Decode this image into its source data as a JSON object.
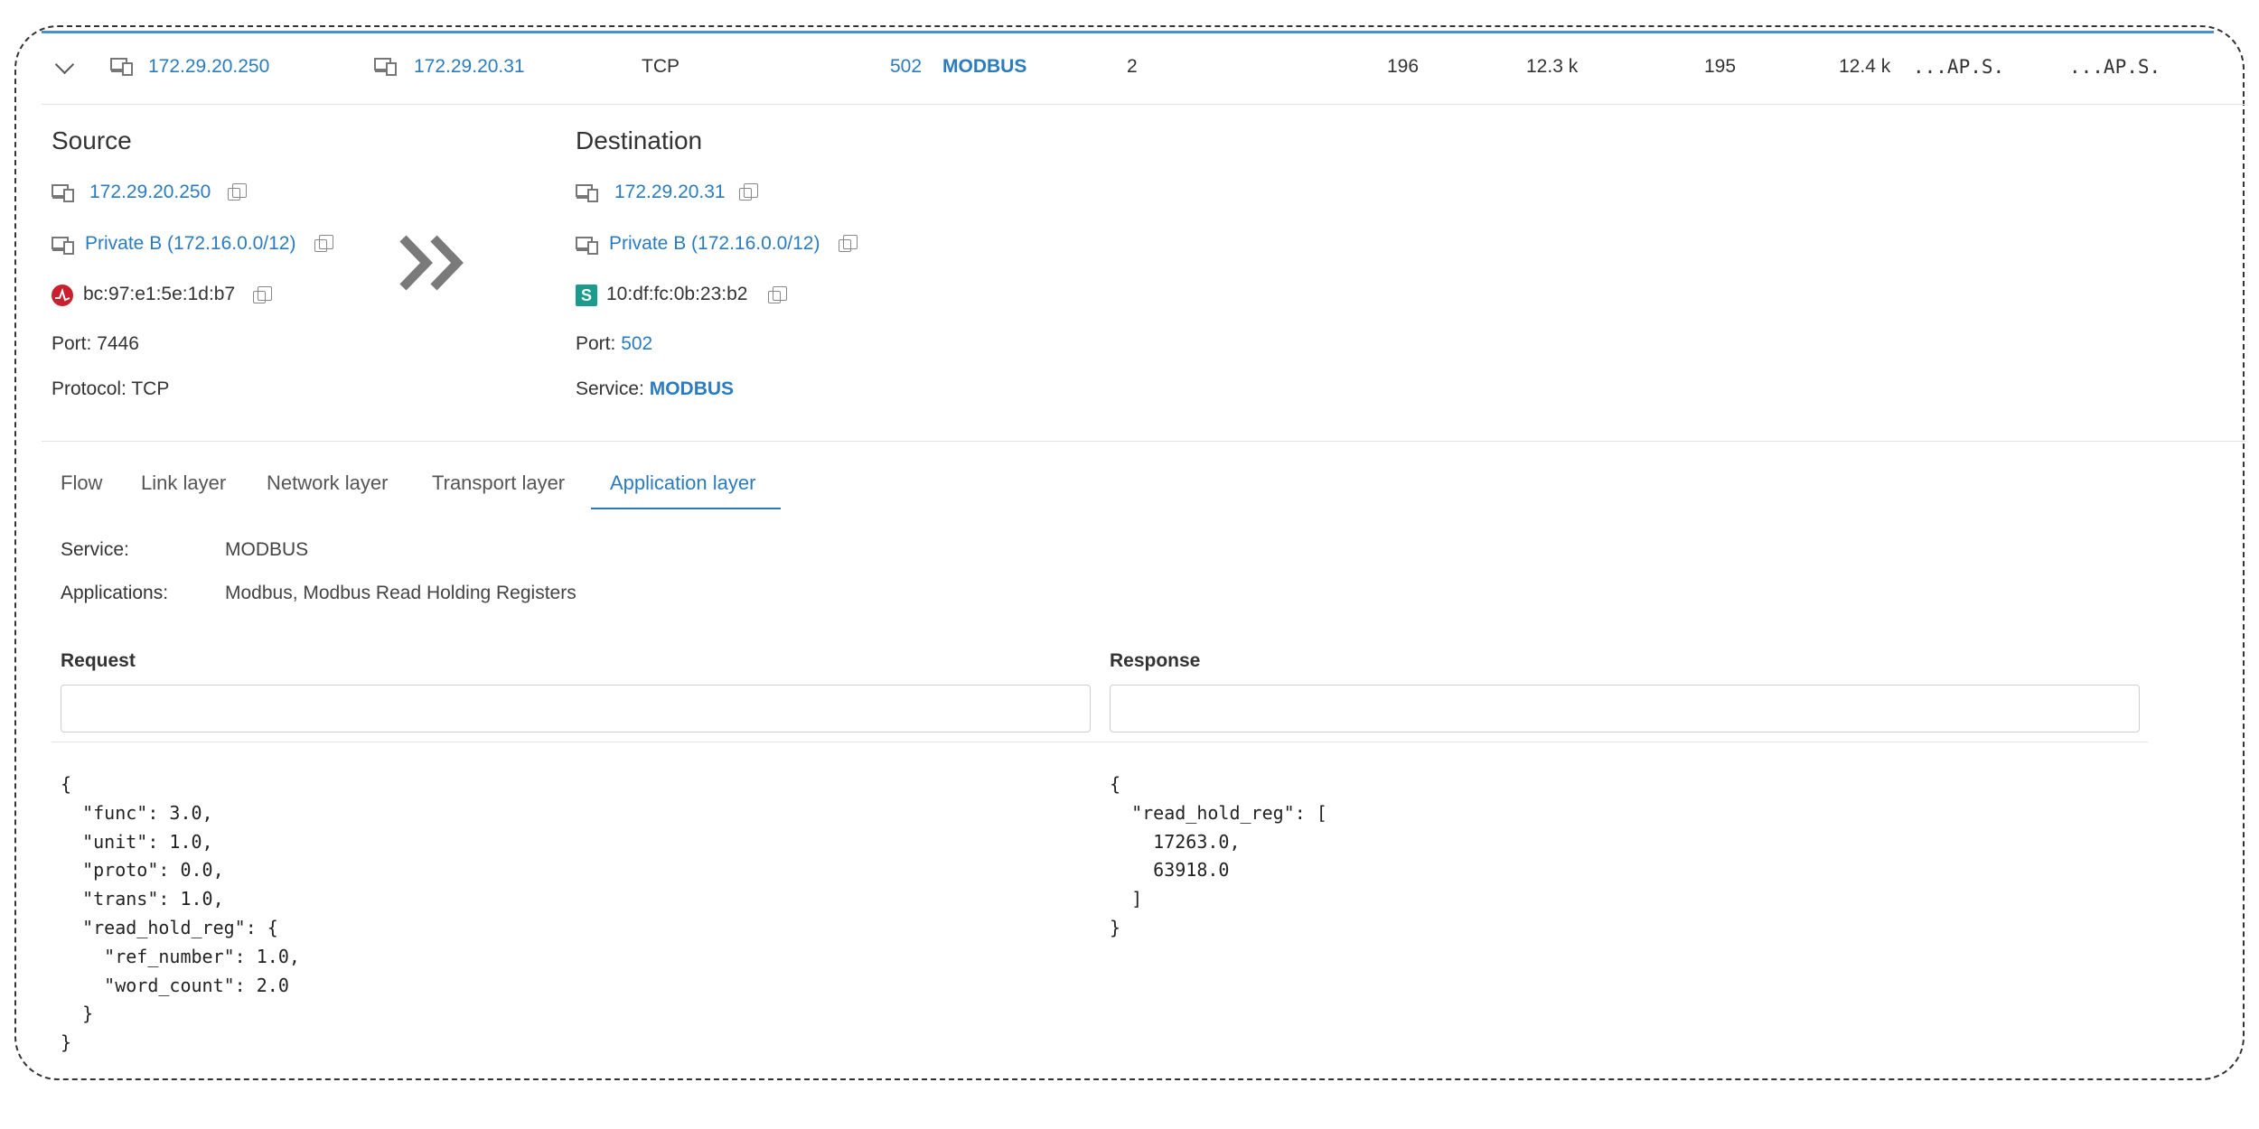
{
  "flow_row": {
    "src_ip": "172.29.20.250",
    "dst_ip": "172.29.20.31",
    "protocol": "TCP",
    "port": "502",
    "service": "MODBUS",
    "packets": "2",
    "src_bytes": "196",
    "src_volume": "12.3 k",
    "dst_bytes": "195",
    "dst_volume": "12.4 k",
    "src_flags": "...AP.S.",
    "dst_flags": "...AP.S."
  },
  "source": {
    "heading": "Source",
    "ip": "172.29.20.250",
    "network": "Private B (172.16.0.0/12)",
    "mac": "bc:97:e1:5e:1d:b7",
    "port_label": "Port:",
    "port_value": "7446",
    "protocol_label": "Protocol:",
    "protocol_value": "TCP"
  },
  "destination": {
    "heading": "Destination",
    "ip": "172.29.20.31",
    "network": "Private B (172.16.0.0/12)",
    "mac": "10:df:fc:0b:23:b2",
    "mac_badge": "S",
    "port_label": "Port:",
    "port_value": "502",
    "service_label": "Service:",
    "service_value": "MODBUS"
  },
  "tabs": [
    {
      "label": "Flow"
    },
    {
      "label": "Link layer"
    },
    {
      "label": "Network layer"
    },
    {
      "label": "Transport layer"
    },
    {
      "label": "Application layer"
    }
  ],
  "active_tab": "Application layer",
  "app_layer": {
    "service_label": "Service:",
    "service_value": "MODBUS",
    "applications_label": "Applications:",
    "applications_value": "Modbus, Modbus Read Holding Registers",
    "request_label": "Request",
    "response_label": "Response",
    "request_filter_value": "",
    "response_filter_value": "",
    "request_json": "{\n  \"func\": 3.0,\n  \"unit\": 1.0,\n  \"proto\": 0.0,\n  \"trans\": 1.0,\n  \"read_hold_reg\": {\n    \"ref_number\": 1.0,\n    \"word_count\": 2.0\n  }\n}",
    "response_json": "{\n  \"read_hold_reg\": [\n    17263.0,\n    63918.0\n  ]\n}"
  },
  "colors": {
    "link": "#2b7bbf",
    "accent_bar": "#4a90c8",
    "vendor_badge_red": "#c8202e",
    "vendor_badge_teal": "#1a9b8c"
  },
  "icons": {
    "host": "device-host-icon",
    "copy": "copy-icon",
    "direction": "double-chevron-right-icon",
    "expand": "chevron-down-icon"
  }
}
